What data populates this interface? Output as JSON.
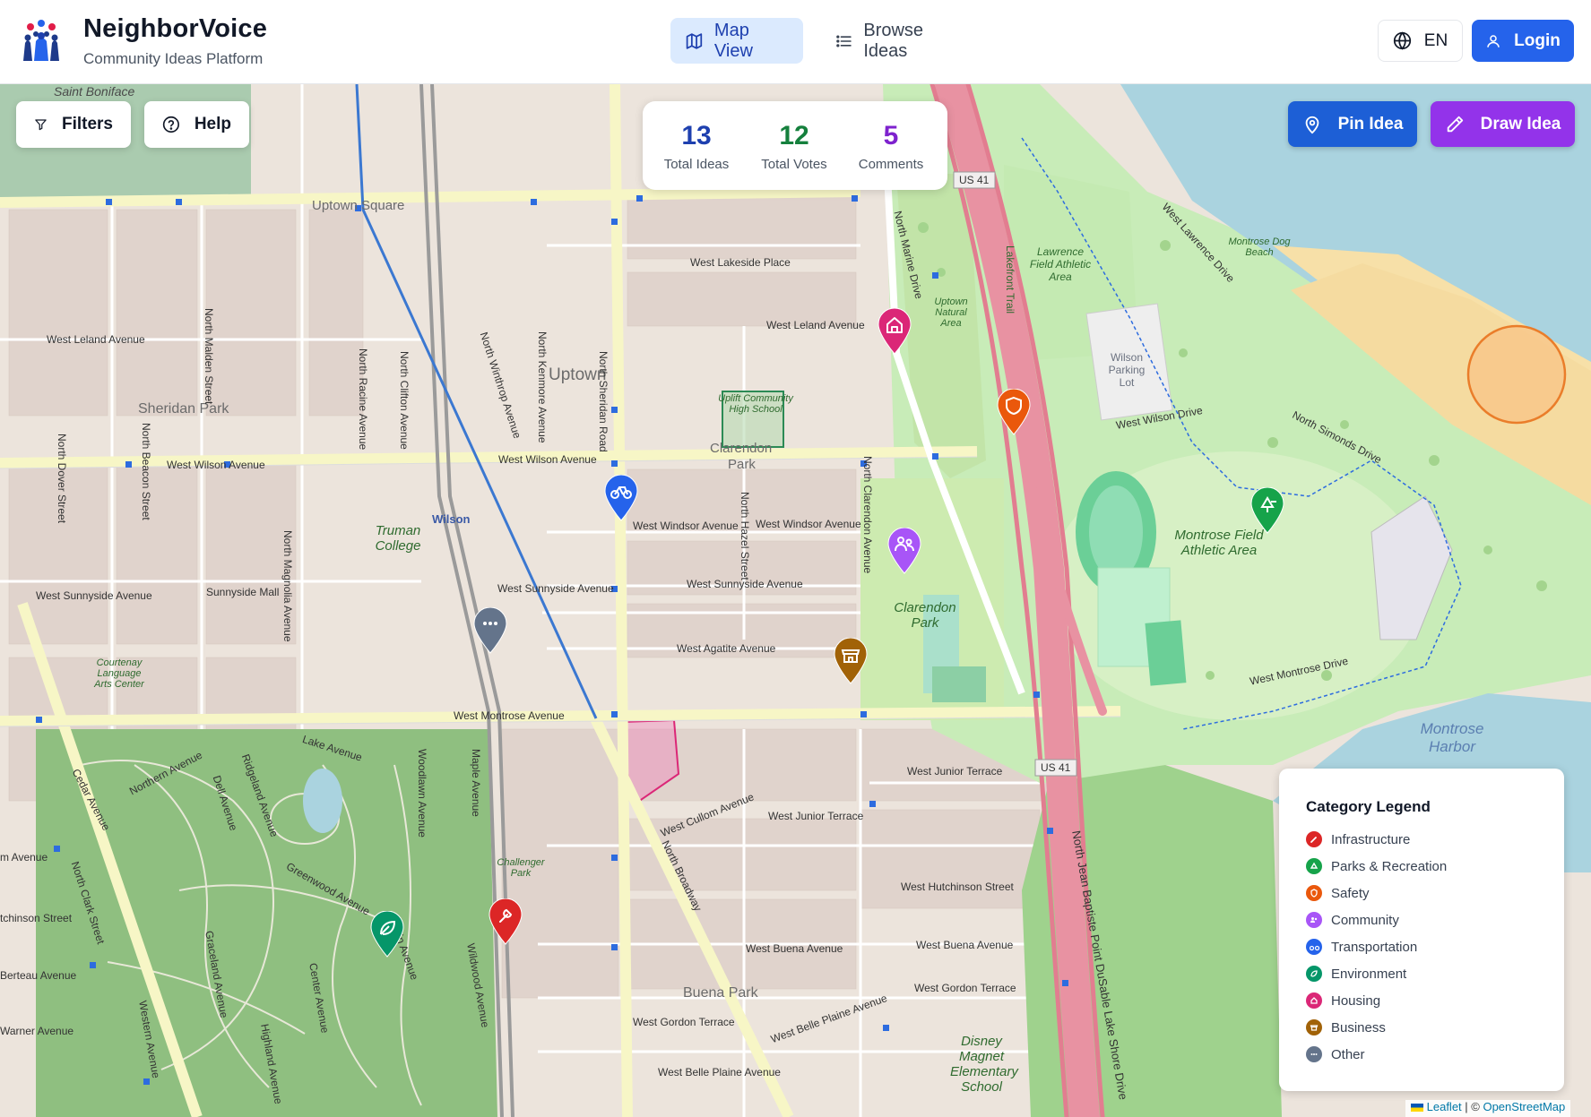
{
  "app": {
    "title": "NeighborVoice",
    "subtitle": "Community Ideas Platform"
  },
  "nav": {
    "map_view": "Map View",
    "browse_ideas": "Browse Ideas"
  },
  "header": {
    "language": "EN",
    "login": "Login"
  },
  "controls": {
    "filters": "Filters",
    "help": "Help",
    "pin_idea": "Pin Idea",
    "draw_idea": "Draw Idea"
  },
  "stats": {
    "total_ideas": {
      "value": "13",
      "label": "Total Ideas",
      "color": "#1e40af"
    },
    "total_votes": {
      "value": "12",
      "label": "Total Votes",
      "color": "#15803d"
    },
    "comments": {
      "value": "5",
      "label": "Comments",
      "color": "#7e22ce"
    }
  },
  "map_labels": {
    "uptown_square": "Uptown Square",
    "saint_boniface": "Saint Boniface",
    "uptown": "Uptown",
    "sheridan_park": "Sheridan Park",
    "truman_college": "Truman College",
    "wilson": "Wilson",
    "clarendon_park": "Clarendon Park",
    "clarendon_park_2": "Clarendon",
    "clarendon_park_3": "Park",
    "uplift": "Uplift Community High School",
    "montrose_field": "Montrose Field Athletic Area",
    "lawrence_field": "Lawrence Field Athletic Area",
    "wilson_lot": "Wilson Parking Lot",
    "montrose_harbor": "Montrose Harbor",
    "montrose_dog_beach": "Montrose Dog Beach",
    "buena_park": "Buena Park",
    "disney": "Disney Magnet Elementary School",
    "courtenay": "Courtenay Language Arts Center",
    "uptown_natural": "Uptown Natural Area",
    "challenger": "Challenger Park",
    "sunnyside_mall": "Sunnyside Mall",
    "us41_a": "US 41",
    "us41_b": "US 41",
    "w_montrose": "West Montrose Avenue",
    "w_wilson": "West Wilson Avenue",
    "w_wilson_2": "West Wilson Avenue",
    "w_leland": "West Leland Avenue",
    "w_leland_2": "West Leland Avenue",
    "w_lakeside": "West Lakeside Place",
    "w_windsor": "West Windsor Avenue",
    "w_windsor_2": "West Windsor Avenue",
    "w_sunnyside": "West Sunnyside Avenue",
    "w_sunnyside_2": "West Sunnyside Avenue",
    "w_sunnyside_3": "West Sunnyside Avenue",
    "w_agatite": "West Agatite Avenue",
    "w_junior": "West Junior Terrace",
    "w_junior_2": "West Junior Terrace",
    "w_hutchinson": "West Hutchinson Street",
    "w_buena": "West Buena Avenue",
    "w_buena_2": "West Buena Avenue",
    "w_gordon": "West Gordon Terrace",
    "w_gordon_2": "West Gordon Terrace",
    "w_belle": "West Belle Plaine Avenue",
    "w_belle_2": "West Belle Plaine Avenue",
    "w_cullom": "West Cullom Avenue",
    "w_montrose_drive": "West Montrose Drive",
    "w_wilson_drive": "West Wilson Drive",
    "n_sheridan": "North Sheridan Road",
    "n_broadway": "North Broadway",
    "n_clarendon": "North Clarendon Avenue",
    "n_marine": "North Marine Drive",
    "n_hazel": "North Hazel Street",
    "n_kenmore": "North Kenmore Avenue",
    "n_racine": "North Racine Avenue",
    "n_magnolia": "North Magnolia Avenue",
    "n_malden": "North Malden Street",
    "n_beacon": "North Beacon Street",
    "n_dover": "North Dover Street",
    "n_clark": "North Clark Street",
    "n_clifton": "North Clifton Avenue",
    "n_winthrop": "North Winthrop Avenue",
    "lsd": "North Jean Baptiste Point DuSable Lake Shore Drive",
    "lakefront_trail": "Lakefront Trail",
    "w_lawrence_drive": "West Lawrence Drive",
    "n_simonds": "North Simonds Drive",
    "lake_avenue": "Lake Avenue",
    "cedar": "Cedar Avenue",
    "northern": "Northern Avenue",
    "dell": "Dell Avenue",
    "ridgeland": "Ridgeland Avenue",
    "greenwood": "Greenwood Avenue",
    "woodlawn": "Woodlawn Avenue",
    "graceland": "Graceland Avenue",
    "center": "Center Avenue",
    "highland": "Highland Avenue",
    "western": "Western Avenue",
    "main": "Main Avenue",
    "wildwood": "Wildwood Avenue",
    "maple": "Maple Avenue",
    "berteau": "Berteau Avenue",
    "warner": "Warner Avenue",
    "hutchinson_w": "tchinson Street",
    "montrose_w": "m Avenue"
  },
  "markers": [
    {
      "category": "Housing",
      "icon": "home-icon",
      "color": "#db2777"
    },
    {
      "category": "Safety",
      "icon": "shield-icon",
      "color": "#ea580c"
    },
    {
      "category": "Parks & Recreation",
      "icon": "tree-icon",
      "color": "#16a34a"
    },
    {
      "category": "Transportation",
      "icon": "bike-icon",
      "color": "#2563eb"
    },
    {
      "category": "Community",
      "icon": "users-icon",
      "color": "#9333ea"
    },
    {
      "category": "Other",
      "icon": "more-icon",
      "color": "#64748b"
    },
    {
      "category": "Business",
      "icon": "store-icon",
      "color": "#a16207"
    },
    {
      "category": "Environment",
      "icon": "leaf-icon",
      "color": "#059669"
    },
    {
      "category": "Infrastructure",
      "icon": "wrench-icon",
      "color": "#dc2626"
    }
  ],
  "legend": {
    "title": "Category Legend",
    "items": [
      {
        "label": "Infrastructure",
        "color": "#dc2626"
      },
      {
        "label": "Parks & Recreation",
        "color": "#16a34a"
      },
      {
        "label": "Safety",
        "color": "#ea580c"
      },
      {
        "label": "Community",
        "color": "#9333ea"
      },
      {
        "label": "Transportation",
        "color": "#2563eb"
      },
      {
        "label": "Environment",
        "color": "#059669"
      },
      {
        "label": "Housing",
        "color": "#db2777"
      },
      {
        "label": "Business",
        "color": "#a16207"
      },
      {
        "label": "Other",
        "color": "#64748b"
      }
    ]
  },
  "attribution": {
    "leaflet": "Leaflet",
    "separator": " | © ",
    "osm": "OpenStreetMap"
  },
  "colors": {
    "primary": "#2563eb",
    "purple": "#9333ea",
    "water": "#aad3df",
    "park": "#cdebb0",
    "highway": "#e892a2"
  }
}
